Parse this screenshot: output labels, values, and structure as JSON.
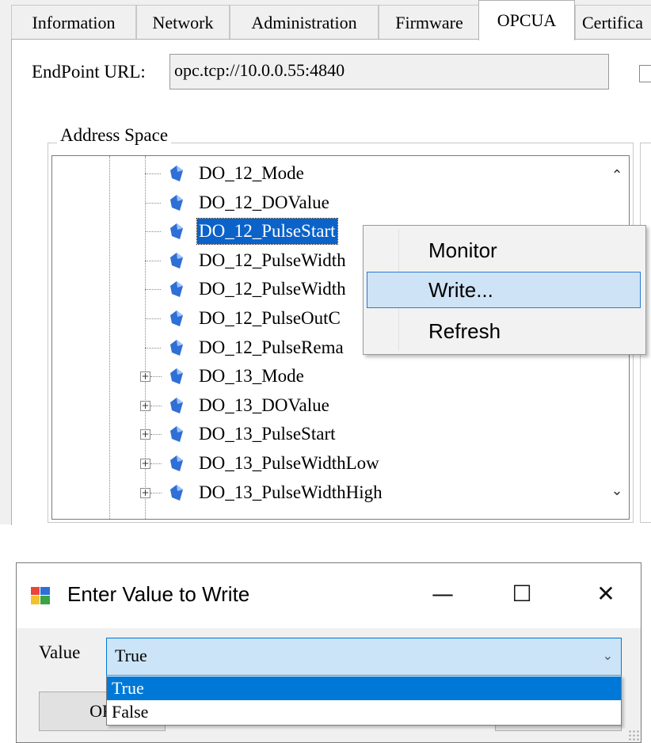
{
  "tabs": [
    "Information",
    "Network",
    "Administration",
    "Firmware",
    "OPCUA",
    "Certifica"
  ],
  "active_tab": "OPCUA",
  "endpoint": {
    "label": "EndPoint URL:",
    "value": "opc.tcp://10.0.0.55:4840"
  },
  "address_space": {
    "title": "Address Space",
    "nodes": [
      {
        "label": "DO_12_Mode",
        "expandable": false
      },
      {
        "label": "DO_12_DOValue",
        "expandable": false
      },
      {
        "label": "DO_12_PulseStart",
        "expandable": false,
        "selected": true
      },
      {
        "label": "DO_12_PulseWidth",
        "expandable": false
      },
      {
        "label": "DO_12_PulseWidth",
        "expandable": false
      },
      {
        "label": "DO_12_PulseOutC",
        "expandable": false
      },
      {
        "label": "DO_12_PulseRema",
        "expandable": false
      },
      {
        "label": "DO_13_Mode",
        "expandable": true
      },
      {
        "label": "DO_13_DOValue",
        "expandable": true
      },
      {
        "label": "DO_13_PulseStart",
        "expandable": true
      },
      {
        "label": "DO_13_PulseWidthLow",
        "expandable": true
      },
      {
        "label": "DO_13_PulseWidthHigh",
        "expandable": true
      }
    ]
  },
  "context_menu": {
    "items": [
      "Monitor",
      "Write...",
      "Refresh"
    ],
    "highlighted": "Write..."
  },
  "dialog": {
    "title": "Enter Value to Write",
    "value_label": "Value",
    "selected_value": "True",
    "options": [
      "True",
      "False"
    ],
    "ok_label": "OK"
  },
  "colors": {
    "selection": "#0b62c9",
    "menu_highlight": "#cfe3f7",
    "node_icon": "#2f6fd6"
  }
}
